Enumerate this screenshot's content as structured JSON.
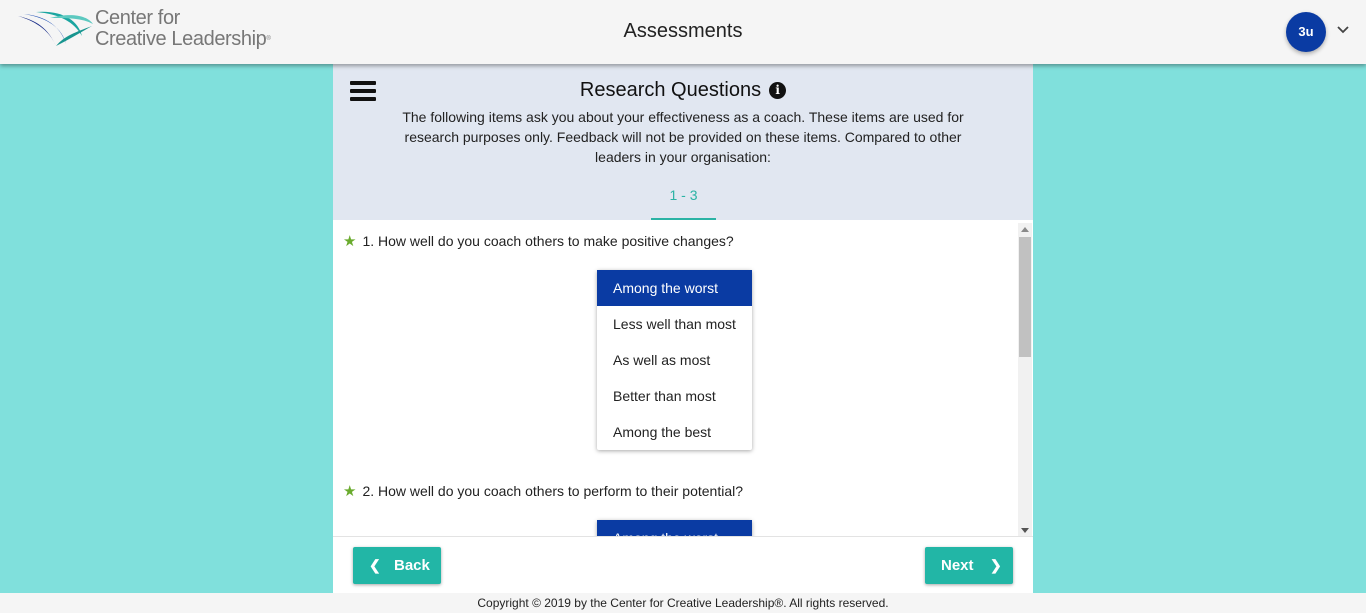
{
  "header": {
    "logo_line1": "Center for",
    "logo_line2": "Creative Leadership",
    "title": "Assessments",
    "avatar_initials": "3u"
  },
  "section": {
    "title": "Research Questions",
    "info_glyph": "i",
    "intro": "The following items ask you about your effectiveness as a coach. These items are used for research purposes only. Feedback will not be provided on these items. Compared to other leaders in your organisation:",
    "page_range": "1 - 3"
  },
  "questions": [
    {
      "number": "1.",
      "text": "How well do you coach others to make positive changes?",
      "options": [
        "Among the worst",
        "Less well than most",
        "As well as most",
        "Better than most",
        "Among the best"
      ],
      "selected": "Among the worst"
    },
    {
      "number": "2.",
      "text": "How well do you coach others to perform to their potential?",
      "options": [
        "Among the worst"
      ],
      "selected": "Among the worst"
    }
  ],
  "nav": {
    "back_label": "Back",
    "next_label": "Next"
  },
  "footer": {
    "copyright": "Copyright © 2019 by the Center for Creative Leadership®. All rights reserved."
  },
  "icons": {
    "menu": "hamburger-menu-icon",
    "info": "info-icon",
    "star": "star-icon",
    "caret": "chevron-down-icon",
    "back": "chevron-left-icon",
    "next": "chevron-right-icon"
  },
  "colors": {
    "page_bg": "#80e0dc",
    "header_bg": "#f5f5f5",
    "panel_head_bg": "#e1e7f1",
    "accent": "#22b6a6",
    "selected_option": "#0a3ba3",
    "star": "#6aab2e"
  }
}
